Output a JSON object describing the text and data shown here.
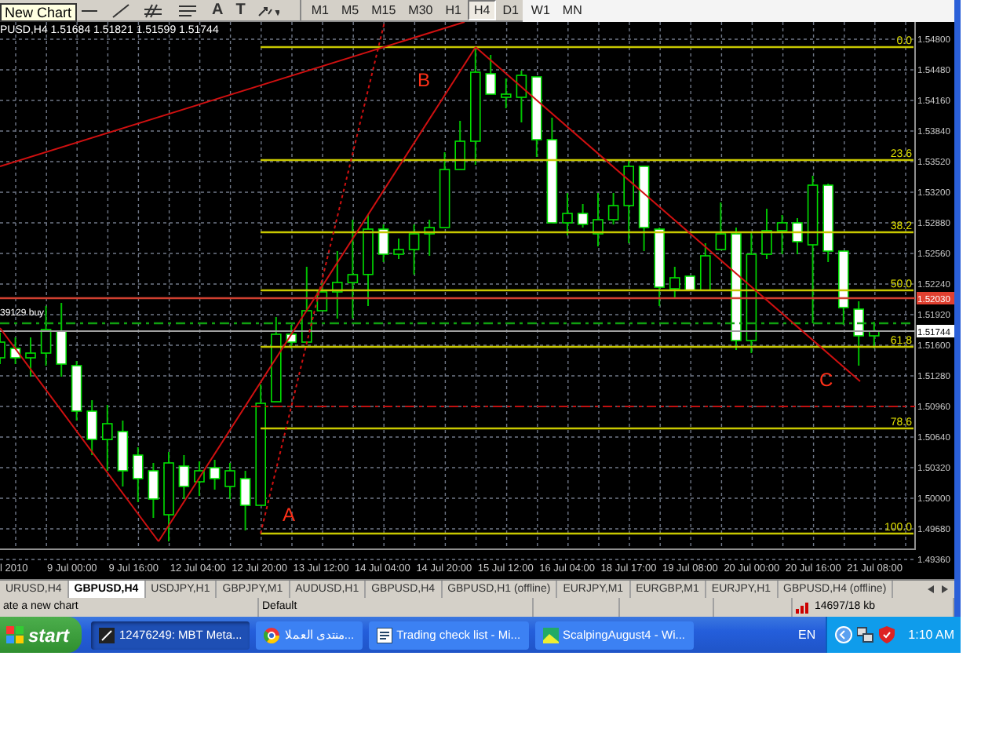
{
  "toolbar": {
    "tooltip": "New Chart",
    "text_tools": [
      "A",
      "T"
    ],
    "timeframes": [
      {
        "label": "M1",
        "selected": false
      },
      {
        "label": "M5",
        "selected": false
      },
      {
        "label": "M15",
        "selected": false
      },
      {
        "label": "M30",
        "selected": false
      },
      {
        "label": "H1",
        "selected": false
      },
      {
        "label": "H4",
        "selected": true
      },
      {
        "label": "D1",
        "selected": false
      },
      {
        "label": "W1",
        "selected": false
      },
      {
        "label": "MN",
        "selected": false
      }
    ]
  },
  "chart": {
    "header": "PUSD,H4  1.51684 1.51821 1.51599 1.51744",
    "order_label": "39129 buy",
    "wave_labels": [
      "A",
      "B",
      "C"
    ],
    "fib_levels": [
      "0.0",
      "23.6",
      "38.2",
      "50.0",
      "61.8",
      "78.6",
      "100.0"
    ],
    "ask_price": "1.52030",
    "bid_price": "1.51744",
    "time_ticks": [
      "l 2010",
      "9 Jul 00:00",
      "9 Jul 16:00",
      "12 Jul 04:00",
      "12 Jul 20:00",
      "13 Jul 12:00",
      "14 Jul 04:00",
      "14 Jul 20:00",
      "15 Jul 12:00",
      "16 Jul 04:00",
      "18 Jul 17:00",
      "19 Jul 08:00",
      "20 Jul 00:00",
      "20 Jul 16:00",
      "21 Jul 08:00"
    ],
    "chart_data": {
      "type": "candlestick",
      "ylim": [
        1.4936,
        1.548
      ],
      "yticks": [
        {
          "value": 1.548,
          "label": "1.54800"
        },
        {
          "value": 1.5448,
          "label": "1.54480"
        },
        {
          "value": 1.5416,
          "label": "1.54160"
        },
        {
          "value": 1.5384,
          "label": "1.53840"
        },
        {
          "value": 1.5352,
          "label": "1.53520"
        },
        {
          "value": 1.532,
          "label": "1.53200"
        },
        {
          "value": 1.5288,
          "label": "1.52880"
        },
        {
          "value": 1.5256,
          "label": "1.52560"
        },
        {
          "value": 1.5224,
          "label": "1.52240"
        },
        {
          "value": 1.5192,
          "label": "1.51920"
        },
        {
          "value": 1.516,
          "label": "1.51600"
        },
        {
          "value": 1.5128,
          "label": "1.51280"
        },
        {
          "value": 1.5096,
          "label": "1.50960"
        },
        {
          "value": 1.5064,
          "label": "1.50640"
        },
        {
          "value": 1.5032,
          "label": "1.50320"
        },
        {
          "value": 1.5,
          "label": "1.50000"
        },
        {
          "value": 1.4968,
          "label": "1.49680"
        },
        {
          "value": 1.4936,
          "label": "1.49360"
        }
      ],
      "grid": true,
      "categories": [
        null,
        null,
        null,
        null,
        null,
        null,
        null,
        null,
        null,
        null,
        null,
        null,
        null,
        null,
        null,
        null,
        null,
        null,
        null,
        null,
        null,
        null,
        null,
        null,
        null,
        null,
        null,
        null,
        null,
        null,
        null,
        null,
        null,
        null,
        null,
        null,
        null,
        null,
        null,
        null,
        null,
        null,
        null,
        null,
        null,
        null,
        null,
        null,
        null,
        null,
        null,
        null,
        null,
        null,
        null,
        null,
        null,
        null
      ],
      "ohlc": [
        [
          1.51469,
          1.51731,
          1.51403,
          1.51633
        ],
        [
          1.51567,
          1.51682,
          1.51403,
          1.51469
        ],
        [
          1.51469,
          1.51682,
          1.51272,
          1.51518
        ],
        [
          1.51518,
          1.5201,
          1.51387,
          1.51764
        ],
        [
          1.51748,
          1.52043,
          1.51272,
          1.51403
        ],
        [
          1.51387,
          1.51436,
          1.50812,
          1.50911
        ],
        [
          1.50911,
          1.51026,
          1.50451,
          1.50615
        ],
        [
          1.50615,
          1.50977,
          1.50287,
          1.5078
        ],
        [
          1.50698,
          1.50812,
          1.50123,
          1.50287
        ],
        [
          1.50451,
          1.50533,
          1.49959,
          1.50205
        ],
        [
          1.50287,
          1.50369,
          1.49795,
          1.49992
        ],
        [
          1.49828,
          1.50484,
          1.49549,
          1.50369
        ],
        [
          1.50336,
          1.50451,
          1.49992,
          1.50123
        ],
        [
          1.50172,
          1.50386,
          1.50025,
          1.50287
        ],
        [
          1.5032,
          1.50402,
          1.5009,
          1.50205
        ],
        [
          1.50123,
          1.50369,
          1.49992,
          1.50287
        ],
        [
          1.50205,
          1.50287,
          1.49664,
          1.49926
        ],
        [
          1.49926,
          1.5119,
          1.49926,
          1.50993
        ],
        [
          1.51009,
          1.51895,
          1.51009,
          1.51715
        ],
        [
          1.51715,
          1.51813,
          1.51567,
          1.51633
        ],
        [
          1.51633,
          1.52421,
          1.51633,
          1.51961
        ],
        [
          1.51961,
          1.52256,
          1.51961,
          1.52158
        ],
        [
          1.52158,
          1.52585,
          1.51879,
          1.52256
        ],
        [
          1.52256,
          1.52913,
          1.51879,
          1.52339
        ],
        [
          1.52339,
          1.52962,
          1.5201,
          1.52814
        ],
        [
          1.52814,
          1.52864,
          1.5247,
          1.52552
        ],
        [
          1.52552,
          1.52716,
          1.52503,
          1.52601
        ],
        [
          1.52601,
          1.52864,
          1.52339,
          1.52765
        ],
        [
          1.52765,
          1.52913,
          1.52535,
          1.52831
        ],
        [
          1.52831,
          1.53618,
          1.52831,
          1.53438
        ],
        [
          1.53438,
          1.53947,
          1.53438,
          1.53733
        ],
        [
          1.53733,
          1.54718,
          1.53487,
          1.54455
        ],
        [
          1.54439,
          1.54636,
          1.54226,
          1.54226
        ],
        [
          1.54193,
          1.5439,
          1.54078,
          1.54226
        ],
        [
          1.54193,
          1.54472,
          1.5393,
          1.54423
        ],
        [
          1.54406,
          1.54406,
          1.53569,
          1.5375
        ],
        [
          1.5375,
          1.53979,
          1.5288,
          1.5288
        ],
        [
          1.5288,
          1.53192,
          1.52749,
          1.52978
        ],
        [
          1.52978,
          1.53077,
          1.52831,
          1.52864
        ],
        [
          1.52765,
          1.53192,
          1.52634,
          1.52913
        ],
        [
          1.52913,
          1.53192,
          1.52864,
          1.53061
        ],
        [
          1.53061,
          1.53536,
          1.52667,
          1.53471
        ],
        [
          1.53471,
          1.53471,
          1.52585,
          1.52831
        ],
        [
          1.52814,
          1.52831,
          1.5201,
          1.52207
        ],
        [
          1.52191,
          1.52421,
          1.52092,
          1.52306
        ],
        [
          1.52322,
          1.52322,
          1.52174,
          1.52174
        ],
        [
          1.52174,
          1.52667,
          1.52174,
          1.52535
        ],
        [
          1.52601,
          1.53093,
          1.52601,
          1.52765
        ],
        [
          1.52765,
          1.52831,
          1.51551,
          1.51649
        ],
        [
          1.51649,
          1.52782,
          1.51518,
          1.52552
        ],
        [
          1.52552,
          1.53028,
          1.52503,
          1.52798
        ],
        [
          1.52798,
          1.52962,
          1.52552,
          1.5288
        ],
        [
          1.5288,
          1.52929,
          1.52552,
          1.52683
        ],
        [
          1.5265,
          1.53372,
          1.5183,
          1.53274
        ],
        [
          1.53274,
          1.5329,
          1.5247,
          1.52585
        ],
        [
          1.52585,
          1.52585,
          1.51813,
          1.51994
        ],
        [
          1.51977,
          1.5206,
          1.51387,
          1.51698
        ],
        [
          1.51698,
          1.51846,
          1.51567,
          1.51748
        ]
      ]
    }
  },
  "chart_tabs": [
    {
      "label": "URUSD,H4",
      "selected": false
    },
    {
      "label": "GBPUSD,H4",
      "selected": true
    },
    {
      "label": "USDJPY,H1",
      "selected": false
    },
    {
      "label": "GBPJPY,M1",
      "selected": false
    },
    {
      "label": "AUDUSD,H1",
      "selected": false
    },
    {
      "label": "GBPUSD,H4",
      "selected": false
    },
    {
      "label": "GBPUSD,H1 (offline)",
      "selected": false
    },
    {
      "label": "EURJPY,M1",
      "selected": false
    },
    {
      "label": "EURGBP,M1",
      "selected": false
    },
    {
      "label": "EURJPY,H1",
      "selected": false
    },
    {
      "label": "GBPUSD,H4 (offline)",
      "selected": false
    }
  ],
  "status_bar": {
    "message": "ate a new chart",
    "profile": "Default",
    "traffic": "14697/18 kb"
  },
  "taskbar": {
    "start": "start",
    "tasks": [
      {
        "kind": "terminal",
        "label": "12476249: MBT Meta...",
        "selected": true
      },
      {
        "kind": "browser",
        "label": "منتدى العملا...",
        "selected": false
      },
      {
        "kind": "document",
        "label": "Trading check list - Mi...",
        "selected": false
      },
      {
        "kind": "image",
        "label": "ScalpingAugust4 - Wi...",
        "selected": false
      }
    ],
    "language": "EN",
    "clock": "1:10 AM"
  }
}
